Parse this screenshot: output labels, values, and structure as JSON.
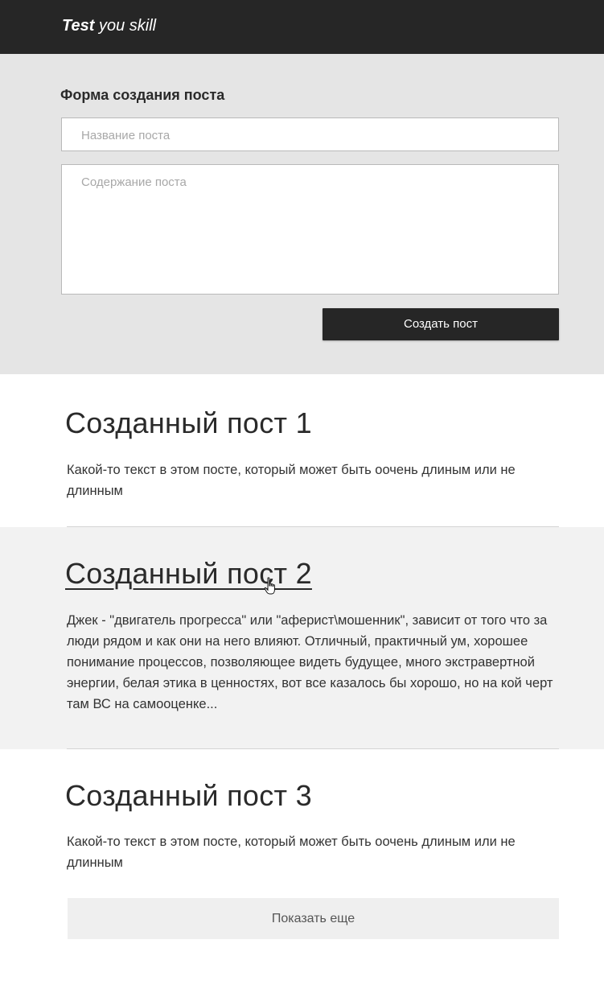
{
  "header": {
    "logo_bold": "Test",
    "logo_rest": " you skill",
    "background": "#262626"
  },
  "form": {
    "title": "Форма создания поста",
    "title_placeholder": "Название поста",
    "body_placeholder": "Содержание поста",
    "submit_label": "Создать пост",
    "background": "#e5e5e5"
  },
  "posts": [
    {
      "title": "Созданный пост 1",
      "text": "Какой-то текст в этом посте, который может быть оочень длиным или не длинным"
    },
    {
      "title": "Созданный пост 2",
      "text": "Джек - \"двигатель прогресса\" или \"аферист\\мошенник\", зависит от того что за люди рядом и как они на него влияют. Отличный, практичный ум, хорошее понимание процессов, позволяющее видеть будущее, много экстравертной энергии, белая этика в ценностях, вот все казалось бы хорошо, но на кой черт там ВС на самооценке...",
      "hovered": true
    },
    {
      "title": "Созданный пост 3",
      "text": "Какой-то текст в этом посте, который может быть оочень длиным или не длинным"
    }
  ],
  "show_more_label": "Показать еще",
  "cursor_icon": "hand-pointer-icon"
}
